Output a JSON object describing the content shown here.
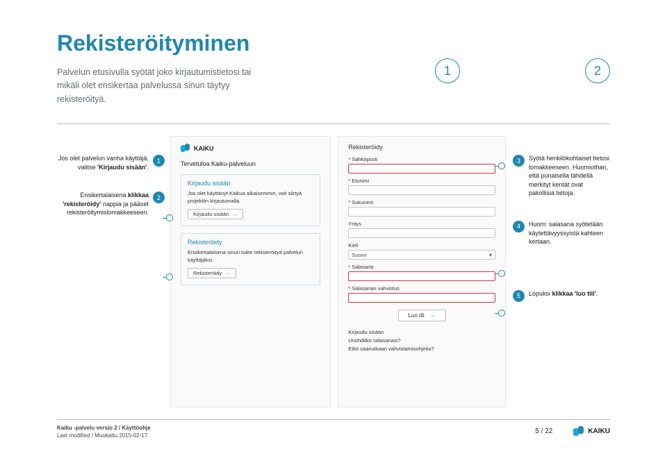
{
  "heading": "Rekisteröityminen",
  "intro": "Palvelun etusivulla syötät joko kirjautumistietosi tai mikäli olet ensikertaa palvelussa sinun täytyy rekisteröityä.",
  "bignums": [
    "1",
    "2"
  ],
  "leftNotes": [
    {
      "num": "1",
      "html": "Jos olet palvelun vanha käyttäjä, valitse <b>'Kirjaudu sisään'</b>."
    },
    {
      "num": "2",
      "html": "Ensikertalaisena <b>klikkaa 'rekisteröidy'</b> nappia ja pääset rekisteröitymislomakkeeseen."
    }
  ],
  "screenshot1": {
    "logo": "KAIKU",
    "welcome": "Tervetuloa Kaiku-palveluun",
    "box1": {
      "title": "Kirjaudu sisään",
      "text": "Jos olet käyttänyt Kaikua aikaisemmin, voit siirtyä projektiin kirjautumalla.",
      "button": "Kirjaudu sisään"
    },
    "box2": {
      "title": "Rekisteröidy",
      "text": "Ensikertalaisena sinun tulee rekisteröityä palvelun käyttäjäksi.",
      "button": "Rekisteröidy"
    }
  },
  "screenshot2": {
    "title": "Rekisteröidy",
    "fields": {
      "email": "* Sähköposti",
      "first": "* Etunimi",
      "last": "* Sukunimi",
      "org": "Yritys",
      "lang": "Kieli",
      "langValue": "Suomi",
      "pw": "* Salasana",
      "pw2": "* Salasanan vahvistus"
    },
    "create": "Luo tili",
    "links": [
      "Kirjaudu sisään",
      "Unohditko salasanasi?",
      "Etkö saanutkaan vahvistamisohjeita?"
    ]
  },
  "rightNotes": [
    {
      "num": "3",
      "text": "Syötä henkilökohtaiset tietosi lomakkeeseen. Huomiothan, että punaisella tähdellä merkityt kentät ovat pakollisia tietoja."
    },
    {
      "num": "4",
      "text": "Huom: salasana syötetään käytettävyyssyistä kahteen kertaan."
    },
    {
      "num": "5",
      "html": "Lopuksi <b>klikkaa 'luo tili'</b>."
    }
  ],
  "footer": {
    "line1": "Kaiku -palvelu versio 2 / Käyttöohje",
    "line2": "Last modified / Muokattu 2015-02-17",
    "page": "5 / 22",
    "brand": "KAIKU"
  }
}
